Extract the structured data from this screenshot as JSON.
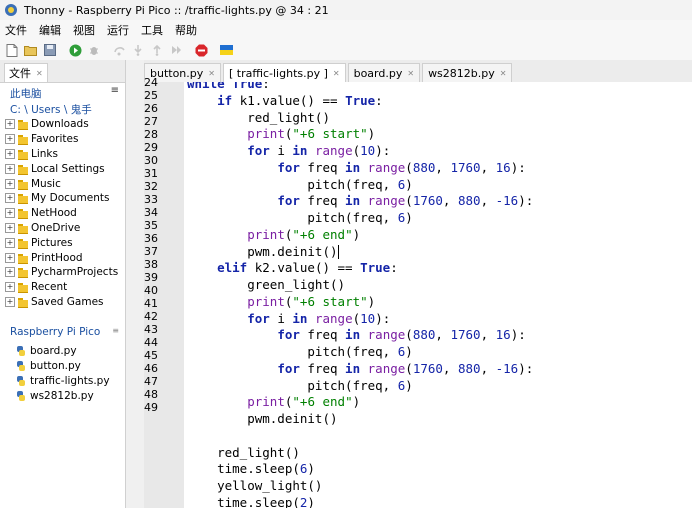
{
  "window": {
    "title": "Thonny  -  Raspberry Pi Pico :: /traffic-lights.py  @  34 : 21"
  },
  "menu": [
    "文件",
    "编辑",
    "视图",
    "运行",
    "工具",
    "帮助"
  ],
  "toolbar": [
    "new-file-icon",
    "open-file-icon",
    "save-icon",
    "run-icon",
    "debug-icon",
    "step-over-icon",
    "step-into-icon",
    "step-out-icon",
    "resume-icon",
    "stop-icon",
    "flag-icon"
  ],
  "sidebar": {
    "tab_label": "文件",
    "computer_header": "此电脑",
    "path": "C: \\ Users \\ 鬼手",
    "folders": [
      "Downloads",
      "Favorites",
      "Links",
      "Local Settings",
      "Music",
      "My Documents",
      "NetHood",
      "OneDrive",
      "Pictures",
      "PrintHood",
      "PycharmProjects",
      "Recent",
      "Saved Games"
    ],
    "device_header": "Raspberry Pi Pico",
    "device_files": [
      "board.py",
      "button.py",
      "traffic-lights.py",
      "ws2812b.py"
    ]
  },
  "editor": {
    "tabs": [
      {
        "label": "button.py",
        "active": false
      },
      {
        "label": "[ traffic-lights.py ]",
        "active": true
      },
      {
        "label": "board.py",
        "active": false
      },
      {
        "label": "ws2812b.py",
        "active": false
      }
    ],
    "line_numbers": [
      "24",
      "25",
      "26",
      "27",
      "28",
      "29",
      "30",
      "31",
      "32",
      "33",
      "34",
      "35",
      "36",
      "37",
      "38",
      "39",
      "40",
      "41",
      "42",
      "43",
      "44",
      "45",
      "46",
      "47",
      "48",
      "49"
    ],
    "lines": [
      "while True:",
      "    if k1.value() == True:",
      "        red_light()",
      "        print(\"+6 start\")",
      "        for i in range(10):",
      "            for freq in range(880, 1760, 16):",
      "                pitch(freq, 6)",
      "            for freq in range(1760, 880, -16):",
      "                pitch(freq, 6)",
      "        print(\"+6 end\")",
      "        pwm.deinit()",
      "    elif k2.value() == True:",
      "        green_light()",
      "        print(\"+6 start\")",
      "        for i in range(10):",
      "            for freq in range(880, 1760, 16):",
      "                pitch(freq, 6)",
      "            for freq in range(1760, 880, -16):",
      "                pitch(freq, 6)",
      "        print(\"+6 end\")",
      "        pwm.deinit()",
      "",
      "    red_light()",
      "    time.sleep(6)",
      "    yellow_light()",
      "    time.sleep(2)"
    ]
  }
}
